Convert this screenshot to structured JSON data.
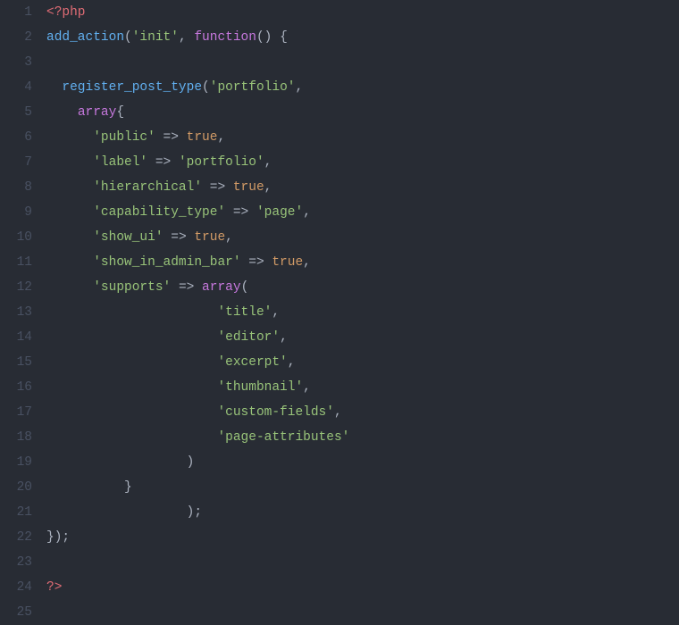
{
  "editor": {
    "lineNumbers": [
      "1",
      "2",
      "3",
      "4",
      "5",
      "6",
      "7",
      "8",
      "9",
      "10",
      "11",
      "12",
      "13",
      "14",
      "15",
      "16",
      "17",
      "18",
      "19",
      "20",
      "21",
      "22",
      "23",
      "24",
      "25"
    ],
    "lines": [
      [
        {
          "t": "t-tag",
          "v": "<?php"
        }
      ],
      [
        {
          "t": "t-fn",
          "v": "add_action"
        },
        {
          "t": "t-punc",
          "v": "("
        },
        {
          "t": "t-str",
          "v": "'init'"
        },
        {
          "t": "t-punc",
          "v": ","
        },
        {
          "t": "t-punc",
          "v": " "
        },
        {
          "t": "t-kw",
          "v": "function"
        },
        {
          "t": "t-punc",
          "v": "()"
        },
        {
          "t": "t-punc",
          "v": " "
        },
        {
          "t": "t-brace",
          "v": "{"
        }
      ],
      [],
      [
        {
          "t": "t-punc",
          "v": "  "
        },
        {
          "t": "t-fn",
          "v": "register_post_type"
        },
        {
          "t": "t-punc",
          "v": "("
        },
        {
          "t": "t-str",
          "v": "'portfolio'"
        },
        {
          "t": "t-punc",
          "v": ","
        }
      ],
      [
        {
          "t": "t-punc",
          "v": "    "
        },
        {
          "t": "t-type",
          "v": "array"
        },
        {
          "t": "t-brace",
          "v": "{"
        }
      ],
      [
        {
          "t": "t-punc",
          "v": "      "
        },
        {
          "t": "t-str",
          "v": "'public'"
        },
        {
          "t": "t-punc",
          "v": " "
        },
        {
          "t": "t-op",
          "v": "=>"
        },
        {
          "t": "t-punc",
          "v": " "
        },
        {
          "t": "t-bool",
          "v": "true"
        },
        {
          "t": "t-punc",
          "v": ","
        }
      ],
      [
        {
          "t": "t-punc",
          "v": "      "
        },
        {
          "t": "t-str",
          "v": "'label'"
        },
        {
          "t": "t-punc",
          "v": " "
        },
        {
          "t": "t-op",
          "v": "=>"
        },
        {
          "t": "t-punc",
          "v": " "
        },
        {
          "t": "t-str",
          "v": "'portfolio'"
        },
        {
          "t": "t-punc",
          "v": ","
        }
      ],
      [
        {
          "t": "t-punc",
          "v": "      "
        },
        {
          "t": "t-str",
          "v": "'hierarchical'"
        },
        {
          "t": "t-punc",
          "v": " "
        },
        {
          "t": "t-op",
          "v": "=>"
        },
        {
          "t": "t-punc",
          "v": " "
        },
        {
          "t": "t-bool",
          "v": "true"
        },
        {
          "t": "t-punc",
          "v": ","
        }
      ],
      [
        {
          "t": "t-punc",
          "v": "      "
        },
        {
          "t": "t-str",
          "v": "'capability_type'"
        },
        {
          "t": "t-punc",
          "v": " "
        },
        {
          "t": "t-op",
          "v": "=>"
        },
        {
          "t": "t-punc",
          "v": " "
        },
        {
          "t": "t-str",
          "v": "'page'"
        },
        {
          "t": "t-punc",
          "v": ","
        }
      ],
      [
        {
          "t": "t-punc",
          "v": "      "
        },
        {
          "t": "t-str",
          "v": "'show_ui'"
        },
        {
          "t": "t-punc",
          "v": " "
        },
        {
          "t": "t-op",
          "v": "=>"
        },
        {
          "t": "t-punc",
          "v": " "
        },
        {
          "t": "t-bool",
          "v": "true"
        },
        {
          "t": "t-punc",
          "v": ","
        }
      ],
      [
        {
          "t": "t-punc",
          "v": "      "
        },
        {
          "t": "t-str",
          "v": "'show_in_admin_bar'"
        },
        {
          "t": "t-punc",
          "v": " "
        },
        {
          "t": "t-op",
          "v": "=>"
        },
        {
          "t": "t-punc",
          "v": " "
        },
        {
          "t": "t-bool",
          "v": "true"
        },
        {
          "t": "t-punc",
          "v": ","
        }
      ],
      [
        {
          "t": "t-punc",
          "v": "      "
        },
        {
          "t": "t-str",
          "v": "'supports'"
        },
        {
          "t": "t-punc",
          "v": " "
        },
        {
          "t": "t-op",
          "v": "=>"
        },
        {
          "t": "t-punc",
          "v": " "
        },
        {
          "t": "t-type",
          "v": "array"
        },
        {
          "t": "t-punc",
          "v": "("
        }
      ],
      [
        {
          "t": "t-punc",
          "v": "                      "
        },
        {
          "t": "t-str",
          "v": "'title'"
        },
        {
          "t": "t-punc",
          "v": ","
        }
      ],
      [
        {
          "t": "t-punc",
          "v": "                      "
        },
        {
          "t": "t-str",
          "v": "'editor'"
        },
        {
          "t": "t-punc",
          "v": ","
        }
      ],
      [
        {
          "t": "t-punc",
          "v": "                      "
        },
        {
          "t": "t-str",
          "v": "'excerpt'"
        },
        {
          "t": "t-punc",
          "v": ","
        }
      ],
      [
        {
          "t": "t-punc",
          "v": "                      "
        },
        {
          "t": "t-str",
          "v": "'thumbnail'"
        },
        {
          "t": "t-punc",
          "v": ","
        }
      ],
      [
        {
          "t": "t-punc",
          "v": "                      "
        },
        {
          "t": "t-str",
          "v": "'custom-fields'"
        },
        {
          "t": "t-punc",
          "v": ","
        }
      ],
      [
        {
          "t": "t-punc",
          "v": "                      "
        },
        {
          "t": "t-str",
          "v": "'page-attributes'"
        }
      ],
      [
        {
          "t": "t-punc",
          "v": "                  )"
        }
      ],
      [
        {
          "t": "t-punc",
          "v": "          "
        },
        {
          "t": "t-brace",
          "v": "}"
        }
      ],
      [
        {
          "t": "t-punc",
          "v": "                  );"
        }
      ],
      [
        {
          "t": "t-brace",
          "v": "}"
        },
        {
          "t": "t-punc",
          "v": ");"
        }
      ],
      [],
      [
        {
          "t": "t-tag",
          "v": "?>"
        }
      ],
      []
    ]
  }
}
